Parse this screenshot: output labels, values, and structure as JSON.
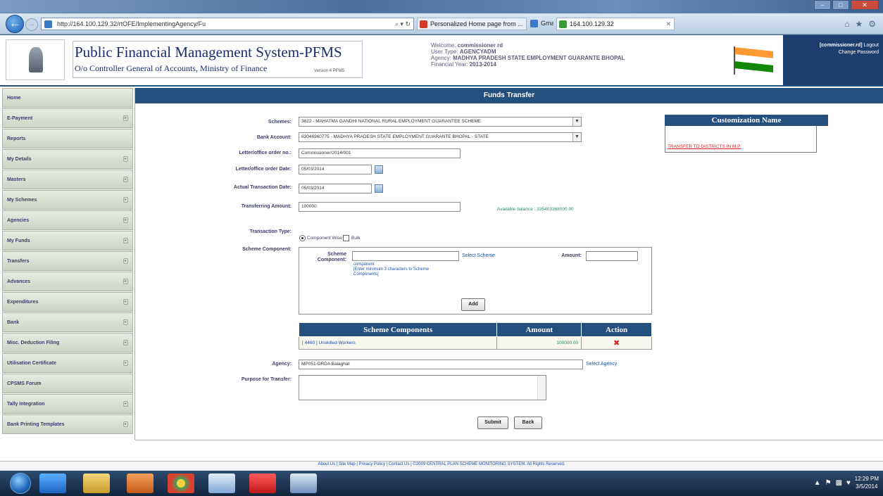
{
  "browser": {
    "address": "http://164.100.129.32/rtOFE/ImplementingAgency/Fu",
    "address_controls": "⌕ ▾ ↻",
    "tabs": [
      {
        "title": "Personalized Home page from ...",
        "color": "#d43a2a"
      },
      {
        "title": "Gmail",
        "color": "#3a78c8"
      },
      {
        "title": "164.100.129.32",
        "color": "#3a9a3a"
      }
    ]
  },
  "header": {
    "title": "Public Financial Management System-PFMS",
    "subtitle": "O/o Controller General of Accounts, Ministry of Finance",
    "version": "Version 4 PFMS",
    "welcome_label": "Welcome:",
    "welcome_user": "commissioner rd",
    "user_type_label": "User Type:",
    "user_type": "AGENCYADM",
    "agency_label": "Agency:",
    "agency": "MADHYA PRADESH STATE EMPLOYMENT GUARANTE BHOPAL",
    "fy_label": "Financial Year:",
    "fy": "2013-2014",
    "user_panel_user": "[commissioner.rd]",
    "logout": "Logout",
    "change_password": "Change Password"
  },
  "sidebar": {
    "items": [
      {
        "label": "Home",
        "arrow": false
      },
      {
        "label": "E-Payment",
        "arrow": true
      },
      {
        "label": "Reports",
        "arrow": false
      },
      {
        "label": "My Details",
        "arrow": true
      },
      {
        "label": "Masters",
        "arrow": true
      },
      {
        "label": "My Schemes",
        "arrow": true
      },
      {
        "label": "Agencies",
        "arrow": true
      },
      {
        "label": "My Funds",
        "arrow": true
      },
      {
        "label": "Transfers",
        "arrow": true
      },
      {
        "label": "Advances",
        "arrow": true
      },
      {
        "label": "Expenditures",
        "arrow": true
      },
      {
        "label": "Bank",
        "arrow": true
      },
      {
        "label": "Misc. Deduction Filing",
        "arrow": true
      },
      {
        "label": "Utilisation Certificate",
        "arrow": true
      },
      {
        "label": "CPSMS Forum",
        "arrow": false
      },
      {
        "label": "Tally Integration",
        "arrow": true
      },
      {
        "label": "Bank Printing Templates",
        "arrow": true
      }
    ]
  },
  "page": {
    "title": "Funds Transfer",
    "scheme_label": "Schemes:",
    "scheme_value": "3822 - MAHATMA GANDHI NATIONAL RURAL EMPLOYMENT GUARANTEE SCHEME",
    "bank_label": "Bank Account:",
    "bank_value": "63046960775 - MADHYA PRADESH STATE EMPLOYMENT GUARANTE BHOPAL - STATE",
    "letter_no_label": "Letter/office order no.:",
    "letter_no_value": "Commissioner/2014/001",
    "letter_date_label": "Letter/office order Date:",
    "letter_date_value": "05/03/2014",
    "txn_date_label": "Actual Transaction Date:",
    "txn_date_value": "05/03/2014",
    "amount_label": "Transferring Amount:",
    "amount_value": "100000",
    "available_balance": "Available balance : 335403368000.00",
    "txn_type_label": "Transaction Type:",
    "txn_type_component": "Component Wise",
    "txn_type_bulk": "Bulk",
    "scheme_component_label": "Scheme Component:",
    "sc_inner_label_1": "Scheme",
    "sc_inner_label_2": "Component:",
    "select_scheme": "Select Scheme",
    "inner_amount_label": "Amount:",
    "hint_1": "component",
    "hint_2": "[Enter minimum 3 characters to Scheme",
    "hint_3": "Components]",
    "add_button": "Add",
    "table_headers": [
      "Scheme Components",
      "Amount",
      "Action"
    ],
    "table_rows": [
      {
        "component": "[ 4460 ] Unskilled Workers",
        "amount": "100000.00",
        "action": "✖"
      }
    ],
    "agency_label": "Agency:",
    "agency_value": "MP051-DRDA Balaghat",
    "select_agency": "Select Agency",
    "purpose_label": "Purpose for Transfer:",
    "submit_button": "Submit",
    "back_button": "Back"
  },
  "customization": {
    "header": "Customization Name",
    "link": "TRANSFER TO DISTRICTS IN M.P."
  },
  "footer": {
    "text": "About Us | Site Map | Privacy Policy | Contact Us | ©2009 CENTRAL PLAN SCHEME MONITORING SYSTEM. All Rights Reserved."
  },
  "taskbar": {
    "time": "12:29 PM",
    "date": "3/5/2014"
  },
  "colors": {
    "brand_blue": "#24507e",
    "link_blue": "#1f4fa8",
    "delete_red": "#d42020"
  }
}
